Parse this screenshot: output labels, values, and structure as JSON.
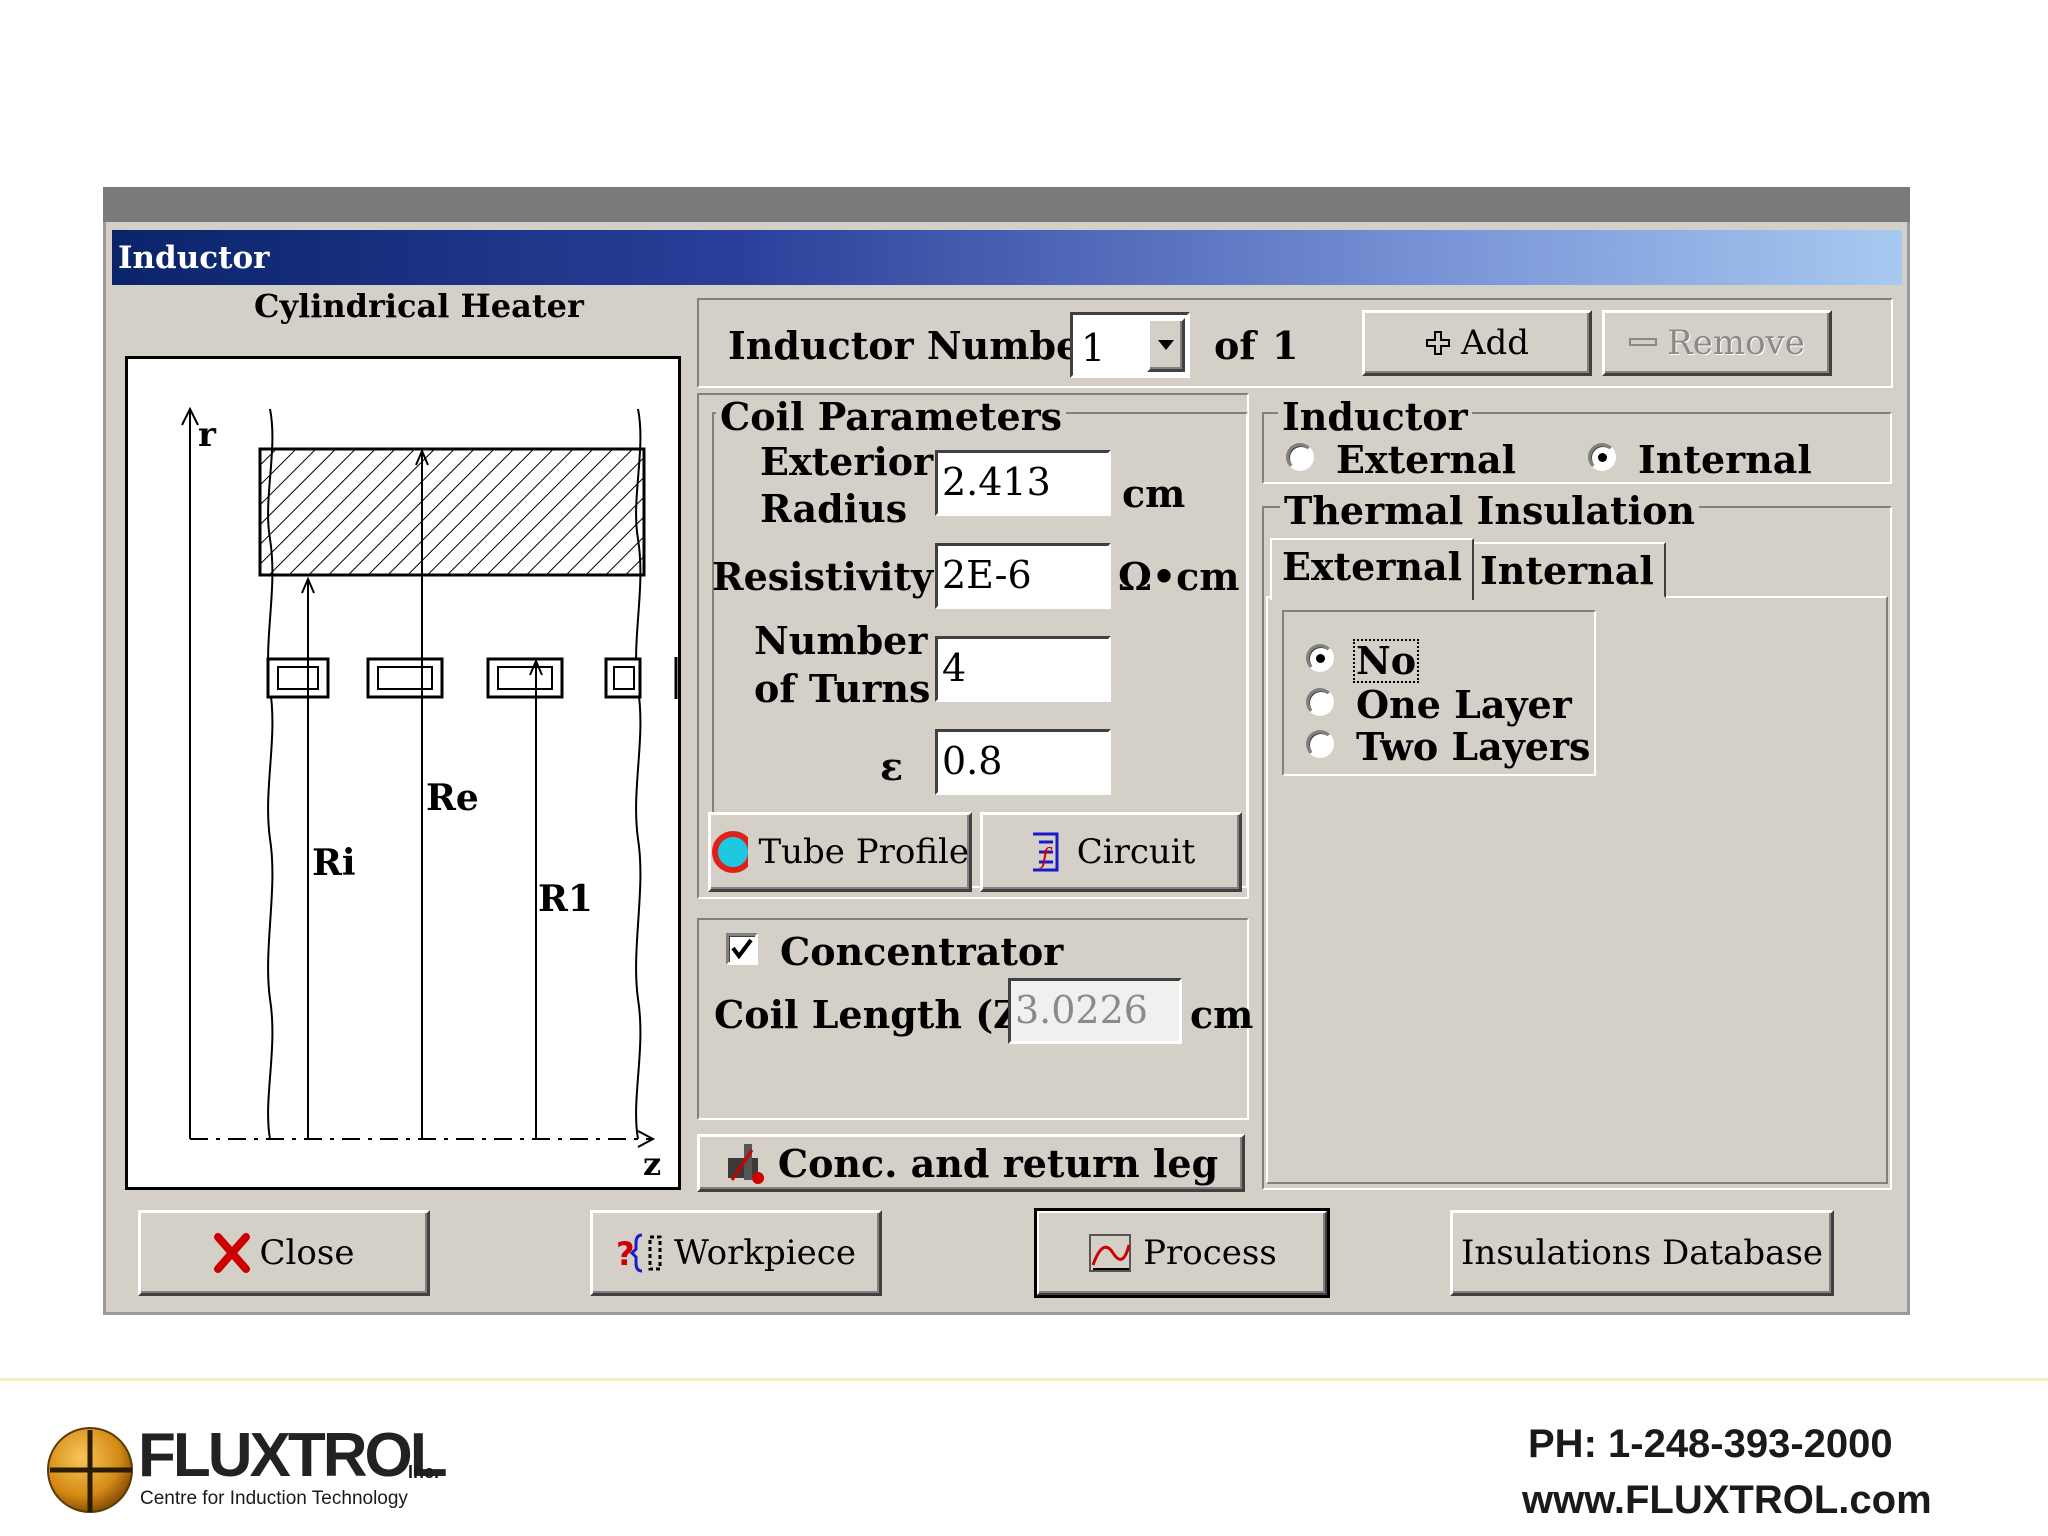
{
  "window": {
    "title": "Inductor"
  },
  "diagram": {
    "title": "Cylindrical Heater",
    "labels": {
      "r": "r",
      "z": "z",
      "ri": "Ri",
      "re": "Re",
      "r1": "R1"
    }
  },
  "inductor_number": {
    "label": "Inductor Number",
    "value": "1",
    "of_label": "of",
    "total": "1",
    "add_label": "Add",
    "remove_label": "Remove"
  },
  "coil_parameters": {
    "title": "Coil Parameters",
    "exterior_radius": {
      "label_line1": "Exterior",
      "label_line2": "Radius",
      "value": "2.413",
      "unit": "cm"
    },
    "resistivity": {
      "label": "Resistivity",
      "value": "2E-6",
      "unit": "Ω•cm"
    },
    "turns": {
      "label_line1": "Number",
      "label_line2": "of Turns",
      "value": "4"
    },
    "epsilon": {
      "label": "ε",
      "value": "0.8"
    },
    "tube_profile_label": "Tube Profile",
    "circuit_label": "Circuit"
  },
  "inductor_type": {
    "title": "Inductor",
    "options": [
      "External",
      "Internal"
    ],
    "selected": "Internal"
  },
  "thermal_insulation": {
    "title": "Thermal Insulation",
    "tabs": [
      "External",
      "Internal"
    ],
    "active_tab": "External",
    "options": [
      "No",
      "One Layer",
      "Two Layers"
    ],
    "selected": "No"
  },
  "concentrator": {
    "label": "Concentrator",
    "checked": true,
    "coil_length_label": "Coil Length (Z)",
    "coil_length_value": "3.0226",
    "unit": "cm",
    "conc_button_label": "Conc. and return leg"
  },
  "bottom_buttons": {
    "close": "Close",
    "workpiece": "Workpiece",
    "process": "Process",
    "insulations_db": "Insulations Database"
  },
  "footer": {
    "logo_brand": "FLUXTROL",
    "logo_suffix": "Inc.",
    "logo_tagline": "Centre for Induction Technology",
    "phone": "PH: 1-248-393-2000",
    "website": "www.FLUXTROL.com"
  },
  "colors": {
    "dialog_bg": "#d4d0c8",
    "title_gradient_start": "#0a246a",
    "title_gradient_end": "#a6caf0",
    "close_icon": "#cc0000",
    "footer_line": "#f3efbc"
  },
  "icons": [
    "add-plus-icon",
    "remove-minus-icon",
    "dropdown-arrow-icon",
    "tube-profile-icon",
    "circuit-icon",
    "conc-leg-icon",
    "close-x-icon",
    "workpiece-icon",
    "process-icon",
    "fluxtrol-logo-icon"
  ]
}
